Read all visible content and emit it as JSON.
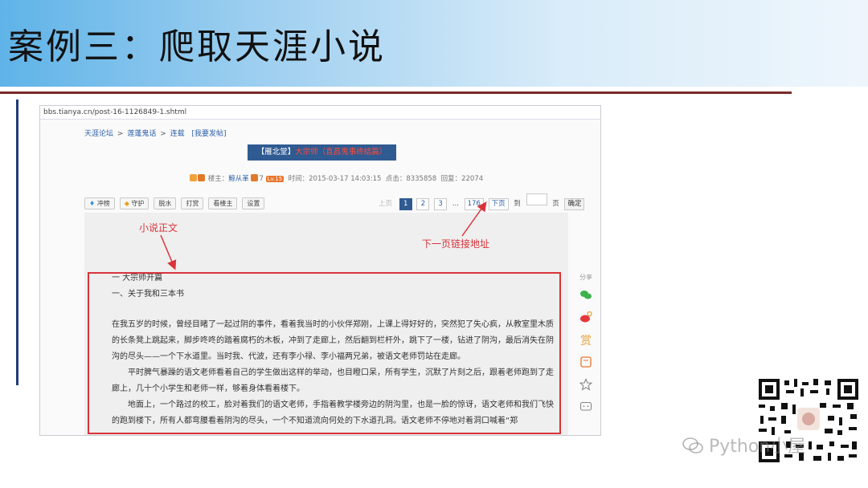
{
  "slide": {
    "title": "案例三：爬取天涯小说"
  },
  "browser": {
    "url": "bbs.tianya.cn/post-16-1126849-1.shtml"
  },
  "breadcrumb": {
    "items": [
      "天涯论坛",
      "莲蓬鬼话",
      "连载"
    ],
    "separator": ">",
    "action": "[我要发帖]"
  },
  "post": {
    "title_prefix": "【雁北堂】",
    "title_main": "大宗师（直昌鬼事终结篇）",
    "author_label": "楼主：",
    "author": "鲸从革",
    "author_score": "7",
    "level": "Lv.15",
    "time_label": "时间：",
    "time": "2015-03-17 14:03:15",
    "clicks_label": "点击：",
    "clicks": "8335858",
    "replies_label": "回复：",
    "replies": "22074"
  },
  "toolbar": {
    "buttons": [
      "冲榜",
      "守护",
      "脱水",
      "打赏",
      "看楼主",
      "设置"
    ]
  },
  "pager": {
    "prev": "上页",
    "pages": [
      "1",
      "2",
      "3"
    ],
    "current": "1",
    "ellipsis": "...",
    "last": "176",
    "next": "下页",
    "goto_label": "到",
    "page_unit": "页",
    "confirm": "确定"
  },
  "novel": {
    "heading1": "一 大宗师开篇",
    "heading2": "一、关于我和三本书",
    "paragraphs": [
      "在我五岁的时候，曾经目睹了一起过阴的事件，看着我当时的小伙伴郑刚，上课上得好好的，突然犯了失心疯，从教室里木质的长条凳上跳起来，脚步咚咚的踏着腐朽的木板，冲到了走廊上，然后翻到栏杆外，跳下了一楼，钻进了阴沟，最后消失在阴沟的尽头——一个下水道里。当时我、代波，还有李小禄、李小福两兄弟，被语文老师罚站在走廊。",
      "平时脾气暴躁的语文老师看着自己的学生做出这样的举动，也目瞪口呆，所有学生，沉默了片刻之后，跟着老师跑到了走廊上，几十个小学生和老师一样，够着身体看着楼下。",
      "地面上，一个路过的校工，脸对着我们的语文老师，手指着教学楼旁边的阴沟里，也是一脸的惊讶，语文老师和我们飞快的跑到楼下，所有人都弯腰看着阴沟的尽头，一个不知道流向何处的下水道孔洞。语文老师不停地对着洞口喊着“郑"
    ]
  },
  "share": {
    "label": "分享",
    "icons": [
      "wechat-icon",
      "weibo-icon",
      "reward-icon",
      "bookmark-icon",
      "star-icon",
      "comment-icon"
    ]
  },
  "annotations": {
    "content_label": "小说正文",
    "next_page_label": "下一页链接地址"
  },
  "watermark": {
    "text": "Python小屋"
  },
  "colors": {
    "annotation": "#d9333a",
    "title_bar": "#2f5b92",
    "header_gradient_start": "#5fb3e8"
  }
}
